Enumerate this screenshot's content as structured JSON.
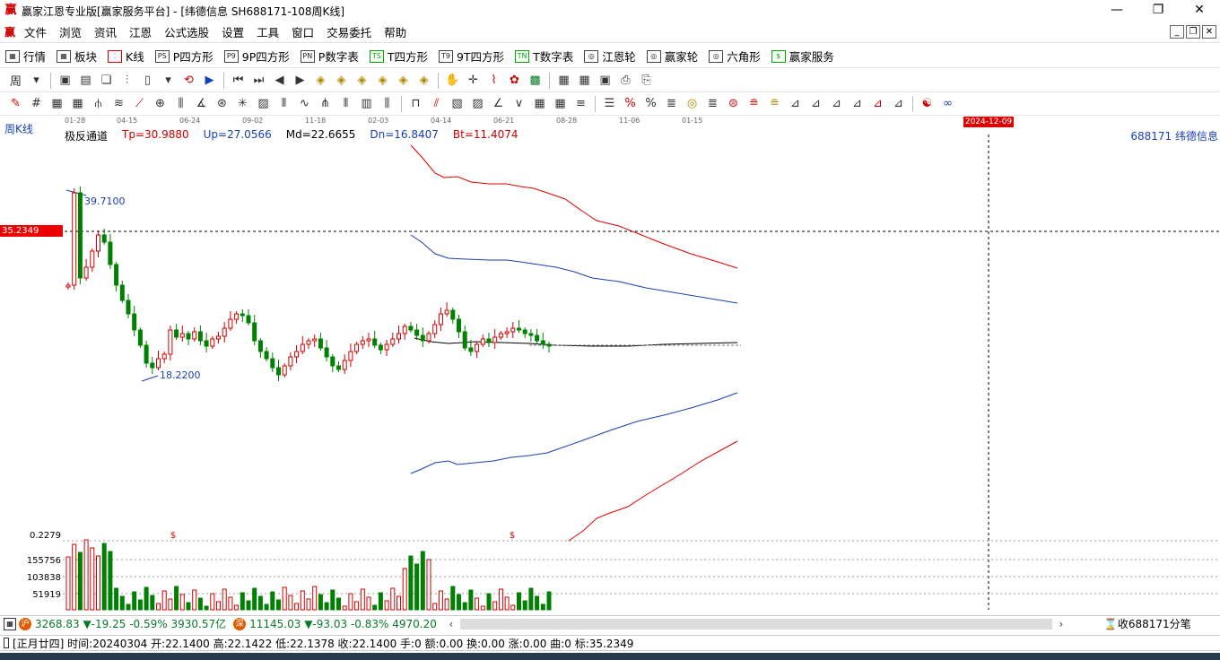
{
  "window": {
    "title": "赢家江恩专业版[赢家服务平台] - [纬德信息  SH688171-108周K线]",
    "app_icon": "赢",
    "controls": [
      "minimize-icon",
      "restore-icon",
      "close-icon"
    ]
  },
  "menu": {
    "logo": "赢",
    "items": [
      "文件",
      "浏览",
      "资讯",
      "江恩",
      "公式选股",
      "设置",
      "工具",
      "窗口",
      "交易委托",
      "帮助"
    ]
  },
  "toolbar1": [
    {
      "icon": "grid-table-icon",
      "glyph": "▦",
      "label": "行情"
    },
    {
      "icon": "sector-icon",
      "glyph": "▦",
      "label": "板块"
    },
    {
      "icon": "kline-icon",
      "glyph": "⫶",
      "label": "K线"
    },
    {
      "icon": "ps-icon",
      "glyph": "PS",
      "label": "P四方形"
    },
    {
      "icon": "p9-icon",
      "glyph": "P9",
      "label": "9P四方形"
    },
    {
      "icon": "pn-icon",
      "glyph": "PN",
      "label": "P数字表"
    },
    {
      "icon": "ts-icon",
      "glyph": "TS",
      "label": "T四方形"
    },
    {
      "icon": "t9-icon",
      "glyph": "T9",
      "label": "9T四方形"
    },
    {
      "icon": "tn-icon",
      "glyph": "TN",
      "label": "T数字表"
    },
    {
      "icon": "gann-wheel-icon",
      "glyph": "◎",
      "label": "江恩轮"
    },
    {
      "icon": "winner-wheel-icon",
      "glyph": "◎",
      "label": "赢家轮"
    },
    {
      "icon": "hexagon-icon",
      "glyph": "◎",
      "label": "六角形"
    },
    {
      "icon": "dollar-icon",
      "glyph": "$",
      "label": "赢家服务"
    }
  ],
  "period_select": "周",
  "chart": {
    "period_label": "周K线",
    "dates": [
      "01-28",
      "04-15",
      "06-24",
      "09-02",
      "11-18",
      "02-03",
      "04-14",
      "06-21",
      "08-28",
      "11-06",
      "01-15"
    ],
    "indicator": {
      "name": "极反通道",
      "tp": "Tp=30.9880",
      "up": "Up=27.0566",
      "md": "Md=22.6655",
      "dn": "Dn=16.8407",
      "bt": "Bt=11.4074"
    },
    "stock_label": "688171  纬德信息",
    "date_marker": "2024-12-09",
    "cursor_price": "35.2349",
    "high_label": "39.7100",
    "low_label": "18.2200",
    "volume_axis": [
      "0.2279",
      "155756",
      "103838",
      "51919"
    ],
    "dollar_mark": "$",
    "up_color": "#d00000",
    "down_color": "#008000"
  },
  "status": {
    "sh_index": "3268.83",
    "sh_change": "▼-19.25",
    "sh_pct": "-0.59%",
    "sh_amount": "3930.57亿",
    "sz_index": "11145.03",
    "sz_change": "▼-93.03",
    "sz_pct": "-0.83%",
    "sz_amount": "4970.20",
    "right_text": "收688171分笔",
    "sh_badge": "沪",
    "sz_badge": "深"
  },
  "info": {
    "text": "[正月廿四] 时间:20240304 开:22.1400 高:22.1422 低:22.1378 收:22.1400 手:0 额:0.00 换:0.00 涨:0.00 曲:0 标:35.2349"
  }
}
